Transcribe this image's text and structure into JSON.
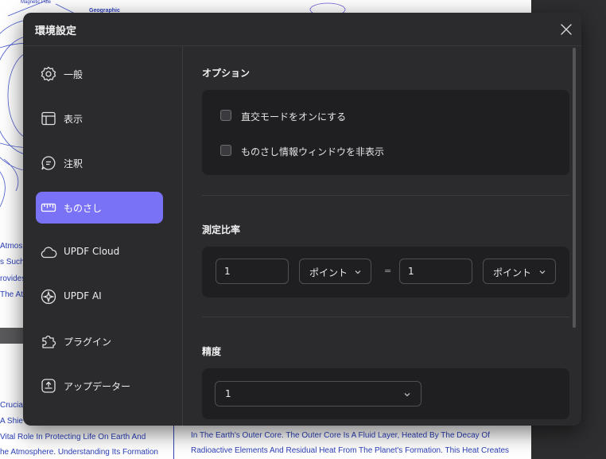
{
  "background_doc": {
    "sketch_labels": [
      "Magnetic Pole",
      "Geographic"
    ],
    "left_fragments": [
      "Atmosp",
      "s Such",
      "rovides",
      "The Atm"
    ],
    "lower_left_lines": [
      "Crucial",
      "A Shie",
      "Vital Role In Protecting Life On Earth And",
      "he Atmosphere. Understanding Its Formation"
    ],
    "lower_right_lines": [
      "In The Earth's Outer Core. The Outer Core Is A Fluid Layer, Heated By The Decay Of",
      "Radioactive Elements And Residual Heat From The Planet's Formation. This Heat Creates"
    ]
  },
  "dialog": {
    "title": "環境設定",
    "close_icon": "close-icon"
  },
  "sidebar": {
    "items": [
      {
        "label": "一般",
        "icon": "gear-icon",
        "active": false
      },
      {
        "label": "表示",
        "icon": "layout-icon",
        "active": false
      },
      {
        "label": "注釈",
        "icon": "comment-icon",
        "active": false
      },
      {
        "label": "ものさし",
        "icon": "ruler-icon",
        "active": true
      },
      {
        "label": "UPDF Cloud",
        "icon": "cloud-icon",
        "active": false
      },
      {
        "label": "UPDF AI",
        "icon": "ai-icon",
        "active": false
      },
      {
        "label": "プラグイン",
        "icon": "puzzle-icon",
        "active": false
      },
      {
        "label": "アップデーター",
        "icon": "update-icon",
        "active": false
      }
    ]
  },
  "options": {
    "title": "オプション",
    "checkbox_orthogonal": {
      "label": "直交モードをオンにする",
      "checked": false
    },
    "checkbox_hide_info": {
      "label": "ものさし情報ウィンドウを非表示",
      "checked": false
    }
  },
  "scale": {
    "title": "測定比率",
    "left_value": "1",
    "left_unit": "ポイント",
    "equals": "=",
    "right_value": "1",
    "right_unit": "ポイント"
  },
  "precision": {
    "title": "精度",
    "value": "1"
  },
  "colors": {
    "accent": "#7a72f6",
    "dialog_bg": "#2b2b2e",
    "card_bg": "#1f1f22"
  }
}
